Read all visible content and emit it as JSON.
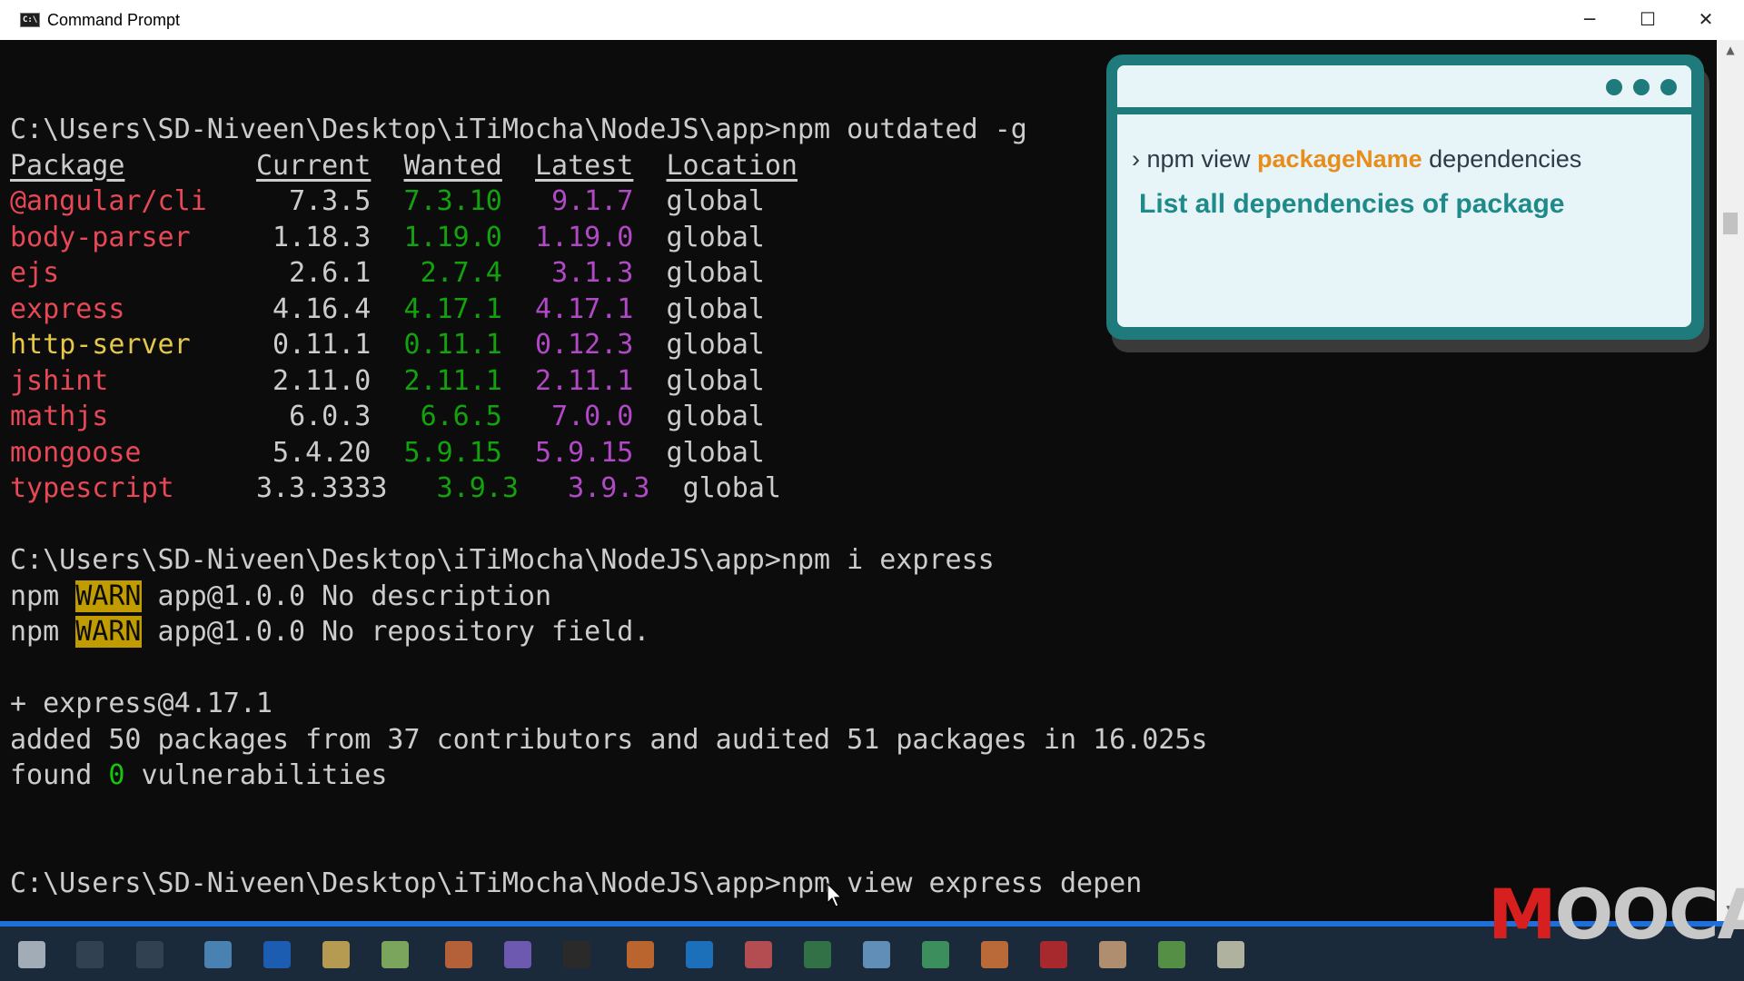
{
  "window": {
    "title": "Command Prompt",
    "icon": "C:\\"
  },
  "window_controls": {
    "minimize": "─",
    "maximize": "☐",
    "close": "✕"
  },
  "terminal": {
    "prompt": "C:\\Users\\SD-Niveen\\Desktop\\iTiMocha\\NodeJS\\app>",
    "cmd1": "npm outdated -g",
    "headers": [
      "Package",
      "Current",
      "Wanted",
      "Latest",
      "Location"
    ],
    "rows": [
      {
        "package": "@angular/cli",
        "current": "7.3.5",
        "wanted": "7.3.10",
        "latest": "9.1.7",
        "location": "global",
        "color": "red"
      },
      {
        "package": "body-parser",
        "current": "1.18.3",
        "wanted": "1.19.0",
        "latest": "1.19.0",
        "location": "global",
        "color": "red"
      },
      {
        "package": "ejs",
        "current": "2.6.1",
        "wanted": "2.7.4",
        "latest": "3.1.3",
        "location": "global",
        "color": "red"
      },
      {
        "package": "express",
        "current": "4.16.4",
        "wanted": "4.17.1",
        "latest": "4.17.1",
        "location": "global",
        "color": "red"
      },
      {
        "package": "http-server",
        "current": "0.11.1",
        "wanted": "0.11.1",
        "latest": "0.12.3",
        "location": "global",
        "color": "yellow"
      },
      {
        "package": "jshint",
        "current": "2.11.0",
        "wanted": "2.11.1",
        "latest": "2.11.1",
        "location": "global",
        "color": "red"
      },
      {
        "package": "mathjs",
        "current": "6.0.3",
        "wanted": "6.6.5",
        "latest": "7.0.0",
        "location": "global",
        "color": "red"
      },
      {
        "package": "mongoose",
        "current": "5.4.20",
        "wanted": "5.9.15",
        "latest": "5.9.15",
        "location": "global",
        "color": "red"
      },
      {
        "package": "typescript",
        "current": "3.3.3333",
        "wanted": "3.9.3",
        "latest": "3.9.3",
        "location": "global",
        "color": "red"
      }
    ],
    "cmd2": "npm i express",
    "npm_label": "npm",
    "warn_label": "WARN",
    "warn1": " app@1.0.0 No description",
    "warn2": " app@1.0.0 No repository field.",
    "added_pkg": "+ express@4.17.1",
    "added_summary": "added 50 packages from 37 contributors and audited 51 packages in 16.025s",
    "found_prefix": "found ",
    "found_count": "0",
    "found_suffix": " vulnerabilities",
    "cmd3": "npm view express depen"
  },
  "tip": {
    "arrow": "›",
    "cmd_prefix": " npm view ",
    "cmd_package": "packageName",
    "cmd_suffix": " dependencies",
    "description": "List all dependencies of package"
  },
  "watermark": {
    "part1": "M",
    "part2": "OOCA"
  },
  "colors": {
    "terminal_bg": "#0c0c0c",
    "terminal_text": "#cccccc",
    "package_red": "#e74856",
    "package_yellow": "#e5c84a",
    "wanted_green": "#13a10e",
    "latest_magenta": "#b148c6",
    "warn_bg": "#c19c00",
    "tip_teal": "#1f7b7b",
    "tip_orange": "#e88c1a"
  }
}
